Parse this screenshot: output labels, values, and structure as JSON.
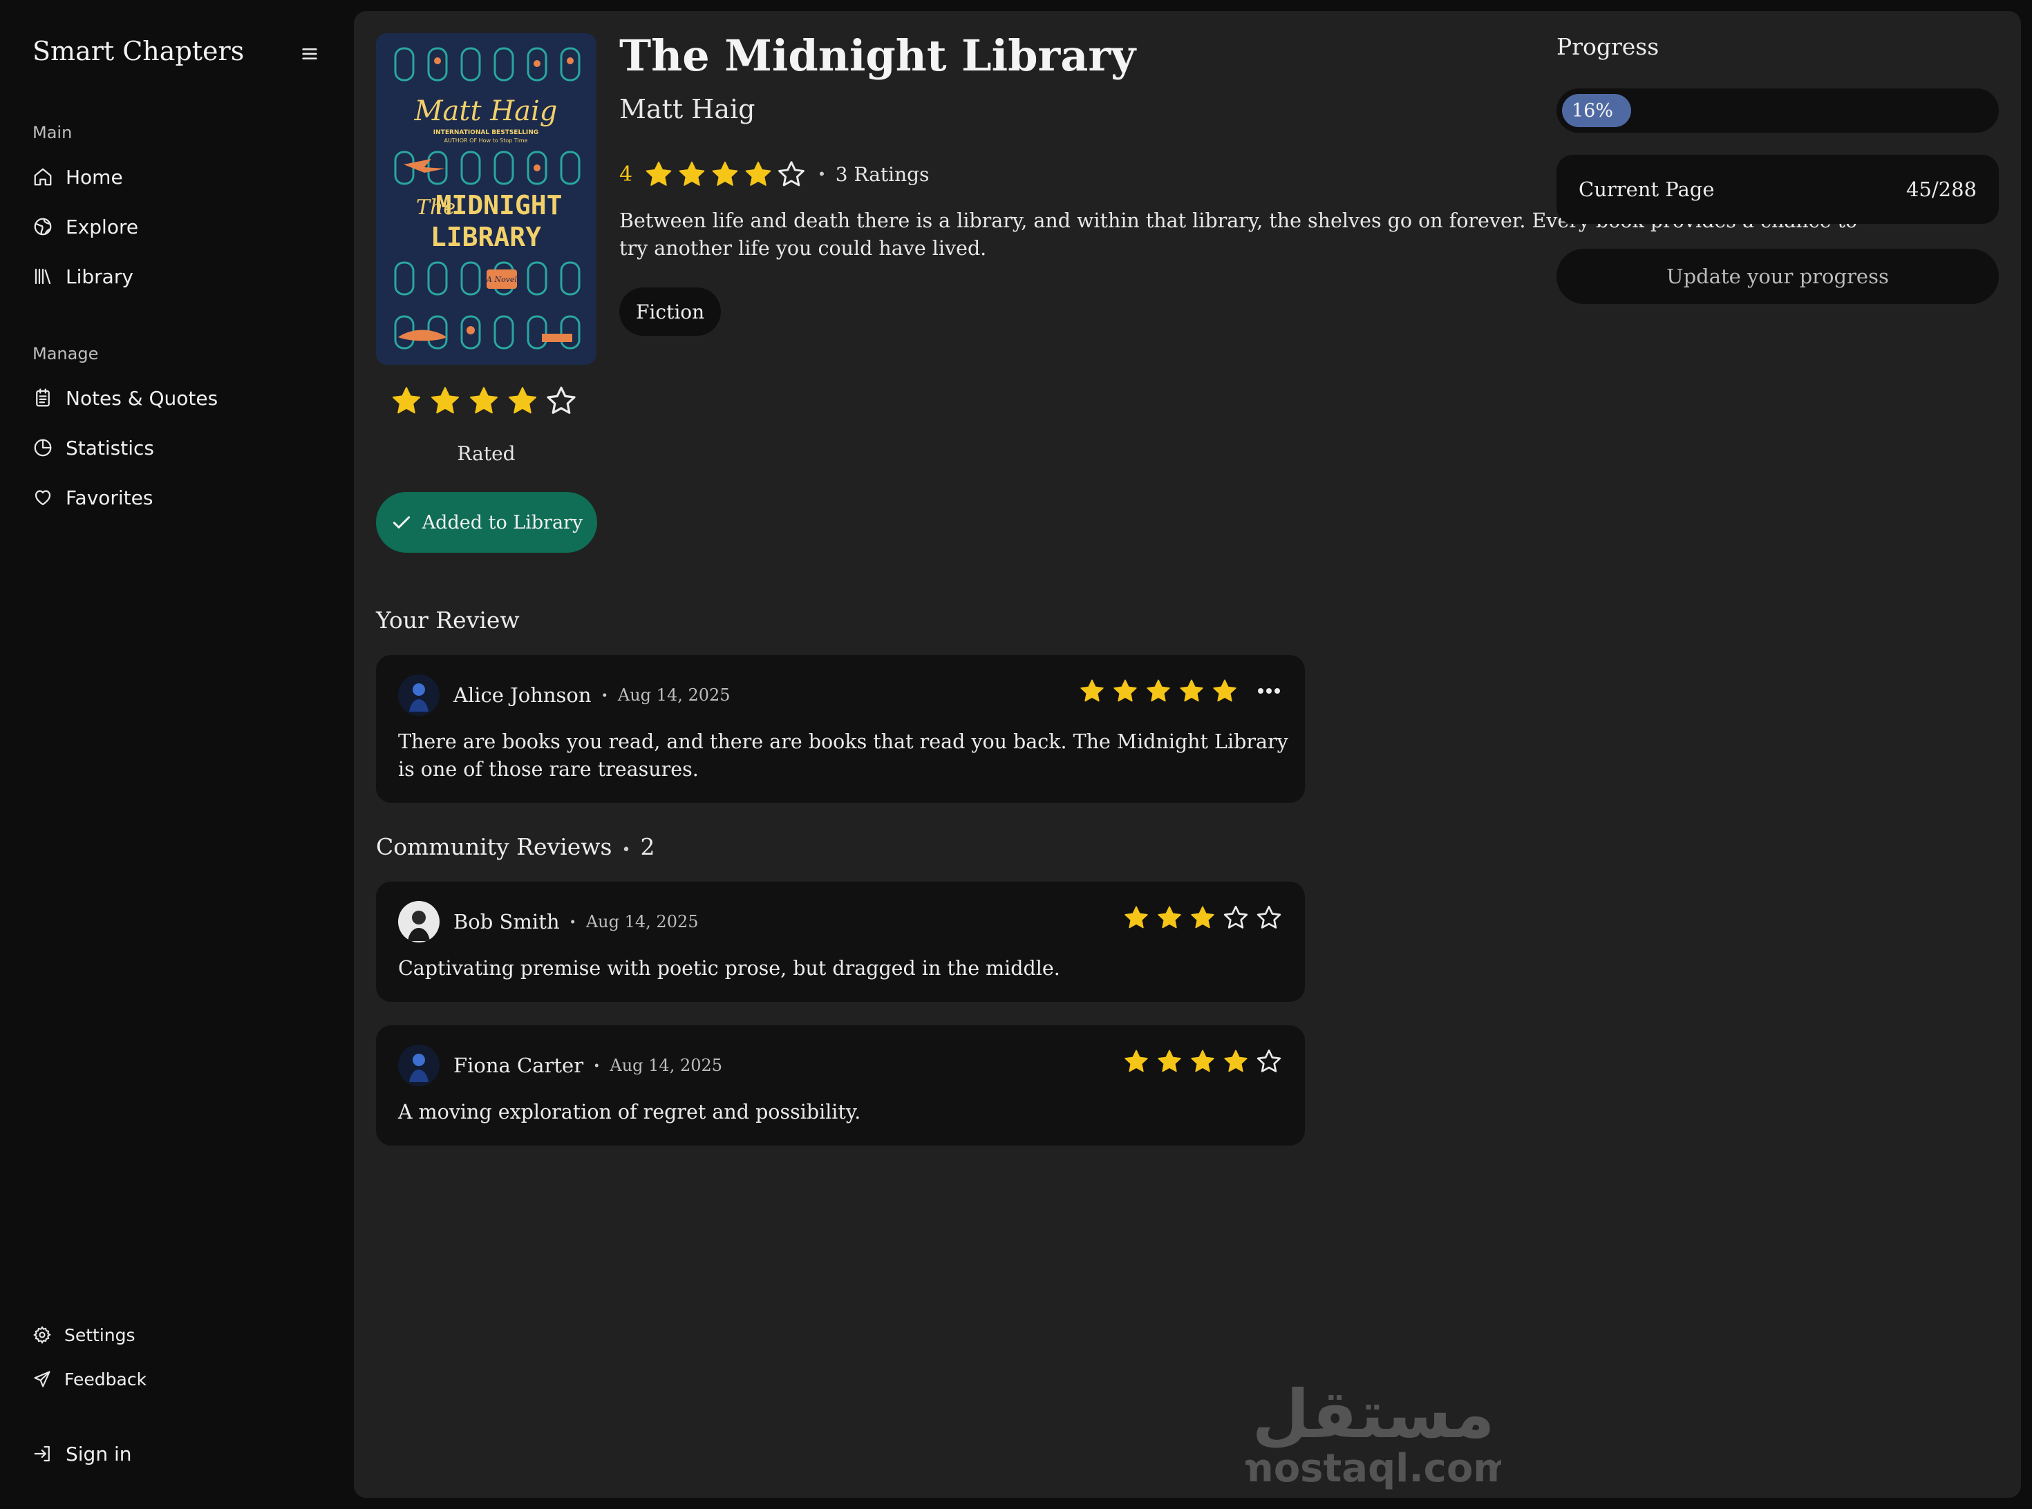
{
  "sidebar": {
    "brand": "Smart Chapters",
    "main_label": "Main",
    "main_items": [
      {
        "label": "Home",
        "icon": "home-icon"
      },
      {
        "label": "Explore",
        "icon": "globe-icon"
      },
      {
        "label": "Library",
        "icon": "library-icon"
      }
    ],
    "manage_label": "Manage",
    "manage_items": [
      {
        "label": "Notes & Quotes",
        "icon": "notes-icon"
      },
      {
        "label": "Statistics",
        "icon": "pie-chart-icon"
      },
      {
        "label": "Favorites",
        "icon": "heart-icon"
      }
    ],
    "footer_items": [
      {
        "label": "Settings",
        "icon": "gear-icon"
      },
      {
        "label": "Feedback",
        "icon": "send-icon"
      }
    ],
    "sign_in": "Sign in"
  },
  "book": {
    "title": "The Midnight Library",
    "author": "Matt Haig",
    "rating": "4",
    "rating_value": 4,
    "ratings_count": "3 Ratings",
    "description": "Between life and death there is a library, and within that library, the shelves go on forever. Every book provides a chance to try another life you could have lived.",
    "genre": "Fiction",
    "cover": {
      "author": "Matt Haig",
      "tagline_1": "INTERNATIONAL BESTSELLING",
      "tagline_2": "AUTHOR OF How to Stop Time",
      "title_the": "The",
      "title_1": "MIDNIGHT",
      "title_2": "LIBRARY",
      "badge": "A Novel"
    }
  },
  "user_rating": {
    "value": 4,
    "label": "Rated",
    "library_button": "Added to Library"
  },
  "progress": {
    "label": "Progress",
    "percent_text": "16%",
    "percent": 16,
    "current_page_label": "Current Page",
    "current_page_value": "45/288",
    "update_button": "Update your progress"
  },
  "your_review": {
    "title": "Your Review",
    "name": "Alice Johnson",
    "date": "Aug 14, 2025",
    "stars": 5,
    "text": "There are books you read, and there are books that read you back. The Midnight Library is one of those rare treasures."
  },
  "community": {
    "title": "Community Reviews",
    "count": "2",
    "reviews": [
      {
        "name": "Bob Smith",
        "date": "Aug 14, 2025",
        "stars": 3,
        "text": "Captivating premise with poetic prose, but dragged in the middle."
      },
      {
        "name": "Fiona Carter",
        "date": "Aug 14, 2025",
        "stars": 4,
        "text": "A moving exploration of regret and possibility."
      }
    ]
  },
  "watermark": {
    "arabic": "مستقل",
    "latin": "mostaql.com"
  },
  "colors": {
    "accent_green": "#0f6e55",
    "star_gold": "#f5c518",
    "progress_blue": "#4f6aa3",
    "panel": "#212121",
    "card": "#111111"
  }
}
